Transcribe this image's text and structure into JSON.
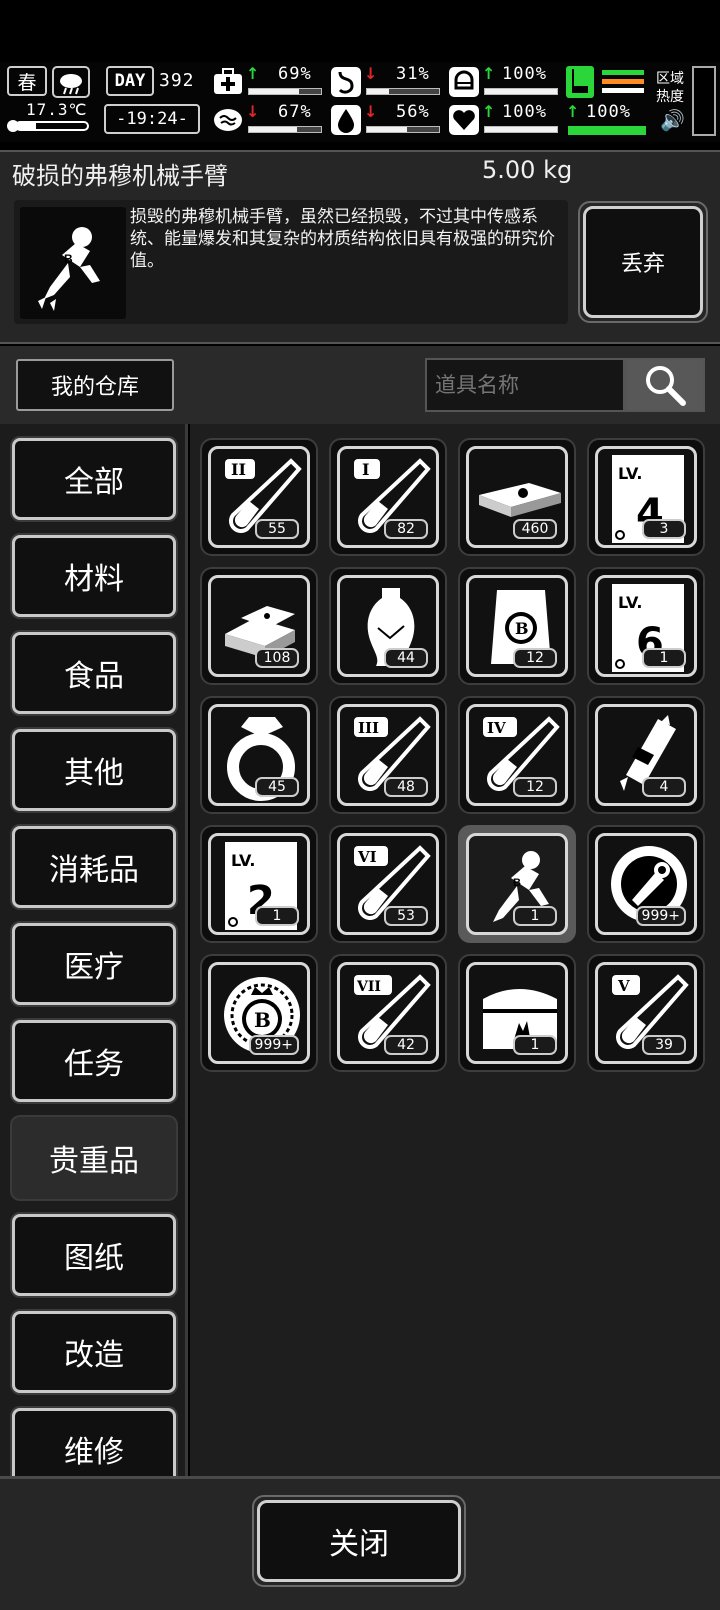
{
  "status": {
    "season": "春",
    "temperature": "17.3℃",
    "day_label": "DAY",
    "day_value": "392",
    "clock": "-19:24-",
    "stats": [
      {
        "name": "health",
        "icon": "medkit-icon",
        "trend": "up",
        "value": "69%",
        "level": 0.69
      },
      {
        "name": "hunger",
        "icon": "stomach-icon",
        "trend": "down",
        "value": "31%",
        "level": 0.31
      },
      {
        "name": "armor",
        "icon": "helmet-icon",
        "trend": "up",
        "value": "100%",
        "level": 1.0
      },
      {
        "name": "mind",
        "icon": "brain-icon",
        "trend": "down",
        "value": "67%",
        "level": 0.67
      },
      {
        "name": "thirst",
        "icon": "water-drop-icon",
        "trend": "down",
        "value": "56%",
        "level": 0.56
      },
      {
        "name": "heart",
        "icon": "heart-icon",
        "trend": "up",
        "value": "100%",
        "level": 1.0
      },
      {
        "name": "stamina",
        "icon": "boot-icon",
        "trend": "up",
        "value": "100%",
        "level": 1.0
      }
    ],
    "zone_label": "区域热度"
  },
  "detail": {
    "title": "破损的弗穆机械手臂",
    "weight": "5.00 kg",
    "description": "损毁的弗穆机械手臂，虽然已经损毁，不过其中传感系统、能量爆发和其复杂的材质结构依旧具有极强的研究价值。",
    "discard_label": "丢弃"
  },
  "toolbar": {
    "warehouse_tab": "我的仓库",
    "search_placeholder": "道具名称"
  },
  "categories": [
    "全部",
    "材料",
    "食品",
    "其他",
    "消耗品",
    "医疗",
    "任务",
    "贵重品",
    "图纸",
    "改造",
    "维修"
  ],
  "active_category": "贵重品",
  "items": [
    {
      "icon": "test-tube-ii-icon",
      "label": "II",
      "count": "55"
    },
    {
      "icon": "test-tube-i-icon",
      "label": "I",
      "count": "82"
    },
    {
      "icon": "cash-stack-icon",
      "label": "",
      "count": "460"
    },
    {
      "icon": "lv4-ticket-icon",
      "label": "4",
      "count": "3"
    },
    {
      "icon": "gold-bars-icon",
      "label": "",
      "count": "108"
    },
    {
      "icon": "vase-icon",
      "label": "",
      "count": "44"
    },
    {
      "icon": "coin-bag-icon",
      "label": "B",
      "count": "12"
    },
    {
      "icon": "lv6-ticket-icon",
      "label": "6",
      "count": "1"
    },
    {
      "icon": "diamond-ring-icon",
      "label": "",
      "count": "45"
    },
    {
      "icon": "test-tube-iii-icon",
      "label": "III",
      "count": "48"
    },
    {
      "icon": "test-tube-iv-icon",
      "label": "IV",
      "count": "12"
    },
    {
      "icon": "broken-mech-part-icon",
      "label": "",
      "count": "4"
    },
    {
      "icon": "lv2-ticket-icon",
      "label": "2",
      "count": "1"
    },
    {
      "icon": "test-tube-vi-icon",
      "label": "VI",
      "count": "53"
    },
    {
      "icon": "broken-robot-arm-icon",
      "label": "",
      "count": "1"
    },
    {
      "icon": "repair-token-icon",
      "label": "",
      "count": "999+"
    },
    {
      "icon": "b-coin-icon",
      "label": "B",
      "count": "999+"
    },
    {
      "icon": "test-tube-vii-icon",
      "label": "VII",
      "count": "42"
    },
    {
      "icon": "treasure-chest-icon",
      "label": "",
      "count": "1"
    },
    {
      "icon": "test-tube-v-icon",
      "label": "V",
      "count": "39"
    }
  ],
  "selected_item_index": 14,
  "footer": {
    "close_label": "关闭"
  }
}
